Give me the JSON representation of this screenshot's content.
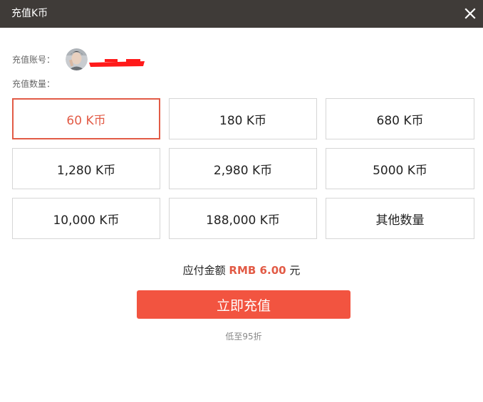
{
  "window": {
    "title": "充值K币",
    "close_icon": "close-icon"
  },
  "account": {
    "label": "充值账号：",
    "avatar_icon": "user-avatar",
    "name_redacted": true
  },
  "amount": {
    "label": "充值数量："
  },
  "options": [
    {
      "label": "60 K币",
      "selected": true
    },
    {
      "label": "180 K币",
      "selected": false
    },
    {
      "label": "680 K币",
      "selected": false
    },
    {
      "label": "1,280 K币",
      "selected": false
    },
    {
      "label": "2,980 K币",
      "selected": false
    },
    {
      "label": "5000 K币",
      "selected": false
    },
    {
      "label": "10,000 K币",
      "selected": false
    },
    {
      "label": "188,000 K币",
      "selected": false
    },
    {
      "label": "其他数量",
      "selected": false
    }
  ],
  "payment": {
    "prefix": "应付金额",
    "amount": "RMB 6.00",
    "suffix": "元"
  },
  "recharge_button": "立即充值",
  "discount_note": "低至95折",
  "colors": {
    "titlebar": "#3f3b38",
    "accent": "#e25b46",
    "button": "#f25440",
    "border": "#d6d6d6"
  }
}
